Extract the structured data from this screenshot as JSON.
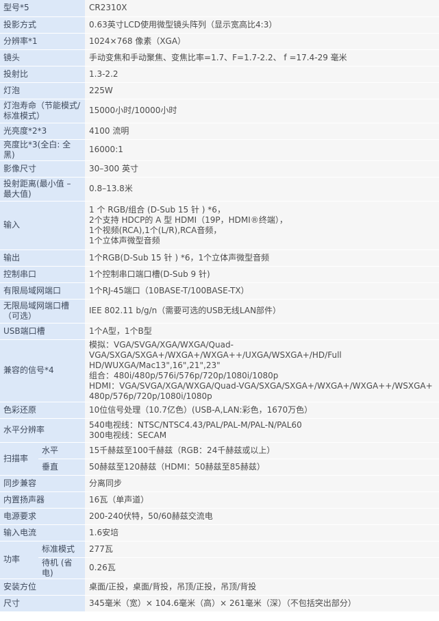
{
  "rows": [
    {
      "label": "型号*5",
      "value": [
        "CR2310X"
      ]
    },
    {
      "label": "投影方式",
      "value": [
        "0.63英寸LCD使用微型镜头阵列（显示宽高比4:3）"
      ]
    },
    {
      "label": "分辨率*1",
      "value": [
        "1024×768 像素（XGA）"
      ]
    },
    {
      "label": "镜头",
      "value": [
        "手动变焦和手动聚焦、变焦比率=1.7、F=1.7-2.2、 f =17.4-29 毫米"
      ]
    },
    {
      "label": "投射比",
      "value": [
        "1.3-2.2"
      ]
    },
    {
      "label": "灯泡",
      "value": [
        "225W"
      ]
    },
    {
      "label": "灯泡寿命（节能模式/标准模式）",
      "value": [
        "15000小时/10000小时"
      ]
    },
    {
      "label": "光亮度*2*3",
      "value": [
        "4100 流明"
      ]
    },
    {
      "label": "亮度比*3(全白: 全黑)",
      "value": [
        "16000:1"
      ]
    },
    {
      "label": "影像尺寸",
      "value": [
        "30–300 英寸"
      ]
    },
    {
      "label": "投射距离(最小值 – 最大值)",
      "value": [
        "0.8–13.8米"
      ]
    },
    {
      "label": "输入",
      "value": [
        "1 个 RGB/组合 (D-Sub 15 针 ) *6，",
        "2个支持 HDCP的 A 型 HDMI（19P，HDMI®终端），",
        "1个视频(RCA),1个(L/R),RCA音频，",
        "1个立体声微型音频"
      ]
    },
    {
      "label": "输出",
      "value": [
        "1个RGB(D-Sub 15 针 ) *6，1个立体声微型音频"
      ]
    },
    {
      "label": "控制串口",
      "value": [
        "1个控制串口端口槽(D-Sub 9 针)"
      ]
    },
    {
      "label": "有限局域网端口",
      "value": [
        "1个RJ-45端口（10BASE-T/100BASE-TX）"
      ]
    },
    {
      "label": "无限局域网端口槽（可选）",
      "value": [
        "IEE 802.11 b/g/n（需要可选的USB无线LAN部件）"
      ]
    },
    {
      "label": "USB端口槽",
      "value": [
        "1个A型，1个B型"
      ]
    },
    {
      "label": "兼容的信号*4",
      "value": [
        "模拟：VGA/SVGA/XGA/WXGA/Quad-",
        "VGA/SXGA/SXGA+/WXGA+/WXGA++/UXGA/WSXGA+/HD/Full",
        "HD/WUXGA/Mac13\",16\",21\",23\"",
        "组合：480i/480p/576i/576p/720p/1080i/1080p",
        "HDMI：VGA/SVGA/XGA/WXGA/Quad-VGA/SXGA/SXGA+/WXGA+/WXGA++/WSXGA+",
        "480p/576p/720p/1080i/1080p"
      ]
    },
    {
      "label": "色彩还原",
      "value": [
        "10位信号处理（10.7亿色）(USB-A,LAN:彩色，1670万色）"
      ]
    },
    {
      "label": "水平分辨率",
      "value": [
        "540电视线：NTSC/NTSC4.43/PAL/PAL-M/PAL-N/PAL60",
        "300电视线：SECAM"
      ]
    }
  ],
  "scan": {
    "label": "扫描率",
    "items": [
      {
        "sublabel": "水平",
        "value": "15千赫兹至100千赫兹（RGB：24千赫兹或以上）"
      },
      {
        "sublabel": "垂直",
        "value": "50赫兹至120赫兹（HDMI：50赫兹至85赫兹）"
      }
    ]
  },
  "rows2": [
    {
      "label": "同步兼容",
      "value": [
        "分离同步"
      ]
    },
    {
      "label": "内置扬声器",
      "value": [
        "16瓦（单声道）"
      ]
    },
    {
      "label": "电源要求",
      "value": [
        "200-240伏特，50/60赫兹交流电"
      ]
    },
    {
      "label": "输入电流",
      "value": [
        "1.6安培"
      ]
    }
  ],
  "power": {
    "label": "功率",
    "items": [
      {
        "sublabel": "标准模式",
        "value": "277瓦"
      },
      {
        "sublabel": "待机 (省电)",
        "value": "0.26瓦"
      }
    ]
  },
  "rows3": [
    {
      "label": "安装方位",
      "value": [
        "桌面/正投，桌面/背投，吊顶/正投，吊顶/背投"
      ]
    },
    {
      "label": "尺寸",
      "value": [
        "345毫米（宽）× 104.6毫米（高）× 261毫米（深）（不包括突出部分）"
      ]
    }
  ]
}
